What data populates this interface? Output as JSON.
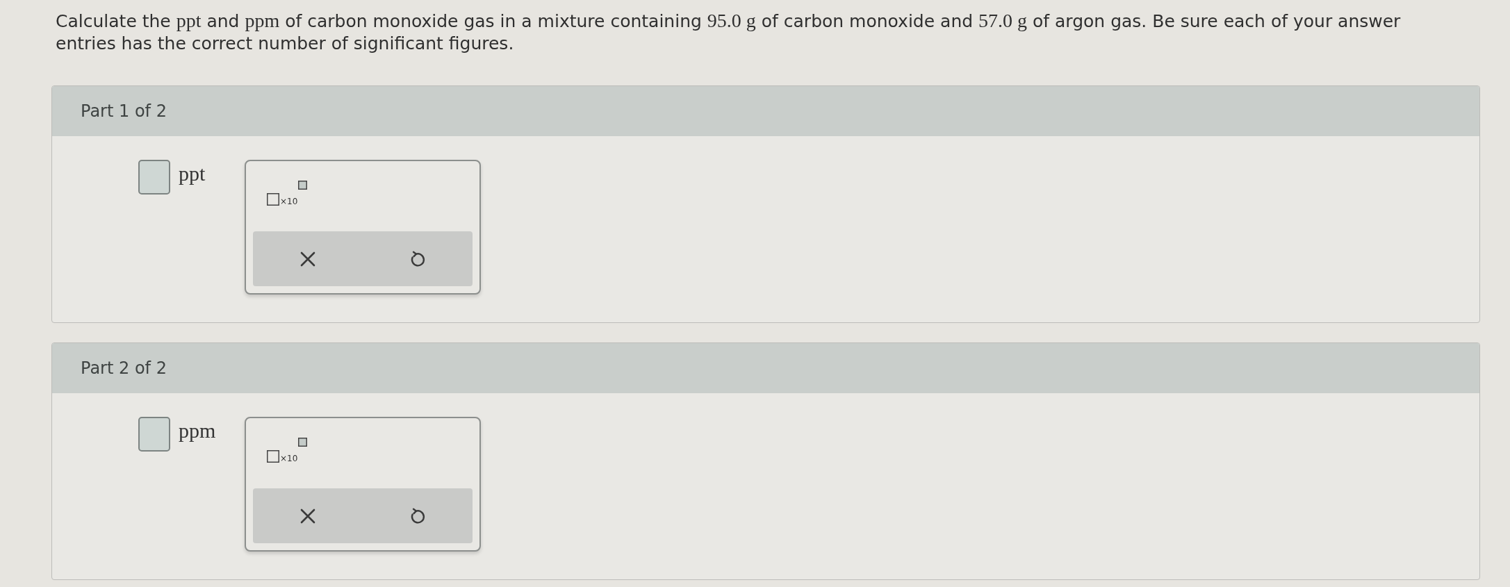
{
  "question": {
    "segments": [
      {
        "kind": "text",
        "text": "Calculate the "
      },
      {
        "kind": "math",
        "text": "ppt"
      },
      {
        "kind": "text",
        "text": " and "
      },
      {
        "kind": "math",
        "text": "ppm"
      },
      {
        "kind": "text",
        "text": " of carbon monoxide gas in a mixture containing "
      },
      {
        "kind": "math",
        "text": "95.0 g"
      },
      {
        "kind": "text",
        "text": " of carbon monoxide and "
      },
      {
        "kind": "math",
        "text": "57.0 g"
      },
      {
        "kind": "text",
        "text": " of argon gas. Be sure each of your answer entries has the correct number of significant figures."
      }
    ]
  },
  "parts": [
    {
      "title": "Part 1 of 2",
      "unit": "ppt",
      "palette": {
        "template_label": "×10"
      }
    },
    {
      "title": "Part 2 of 2",
      "unit": "ppm",
      "palette": {
        "template_label": "×10"
      }
    }
  ]
}
